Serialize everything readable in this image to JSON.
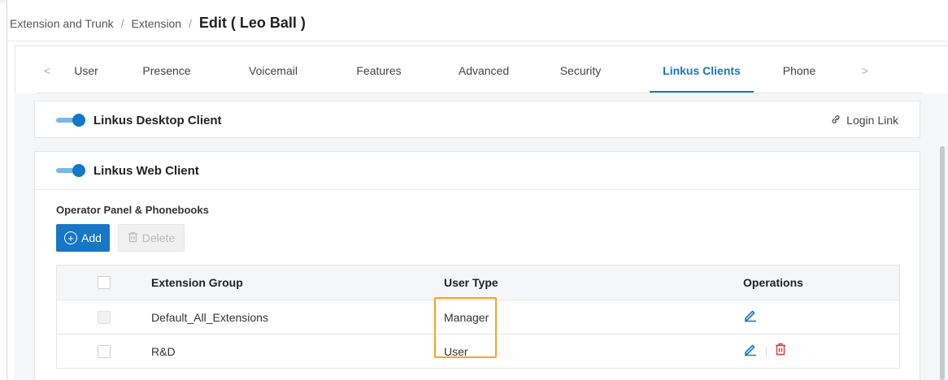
{
  "breadcrumb": {
    "items": [
      "Extension and Trunk",
      "Extension"
    ],
    "current": "Edit ( Leo Ball )",
    "separator": "/"
  },
  "tabs": {
    "prev_arrow": "<",
    "next_arrow": ">",
    "items": [
      {
        "label": "User"
      },
      {
        "label": "Presence"
      },
      {
        "label": "Voicemail"
      },
      {
        "label": "Features"
      },
      {
        "label": "Advanced"
      },
      {
        "label": "Security"
      },
      {
        "label": "Linkus Clients"
      },
      {
        "label": "Phone"
      }
    ],
    "active": "Linkus Clients"
  },
  "desktop_client": {
    "title": "Linkus Desktop Client",
    "enabled": true,
    "login_link_label": "Login Link",
    "login_link_icon": "link-icon"
  },
  "web_client": {
    "title": "Linkus Web Client",
    "enabled": true,
    "section_label": "Operator Panel & Phonebooks",
    "add_label": "Add",
    "delete_label": "Delete",
    "table": {
      "headers": {
        "group": "Extension Group",
        "type": "User Type",
        "operations": "Operations"
      },
      "rows": [
        {
          "group": "Default_All_Extensions",
          "type": "Manager",
          "checkbox_disabled": true,
          "can_delete": false
        },
        {
          "group": "R&D",
          "type": "User",
          "checkbox_disabled": false,
          "can_delete": true
        }
      ]
    }
  },
  "colors": {
    "accent": "#1677c5",
    "danger": "#e23a3a",
    "highlight": "#f5a623"
  }
}
